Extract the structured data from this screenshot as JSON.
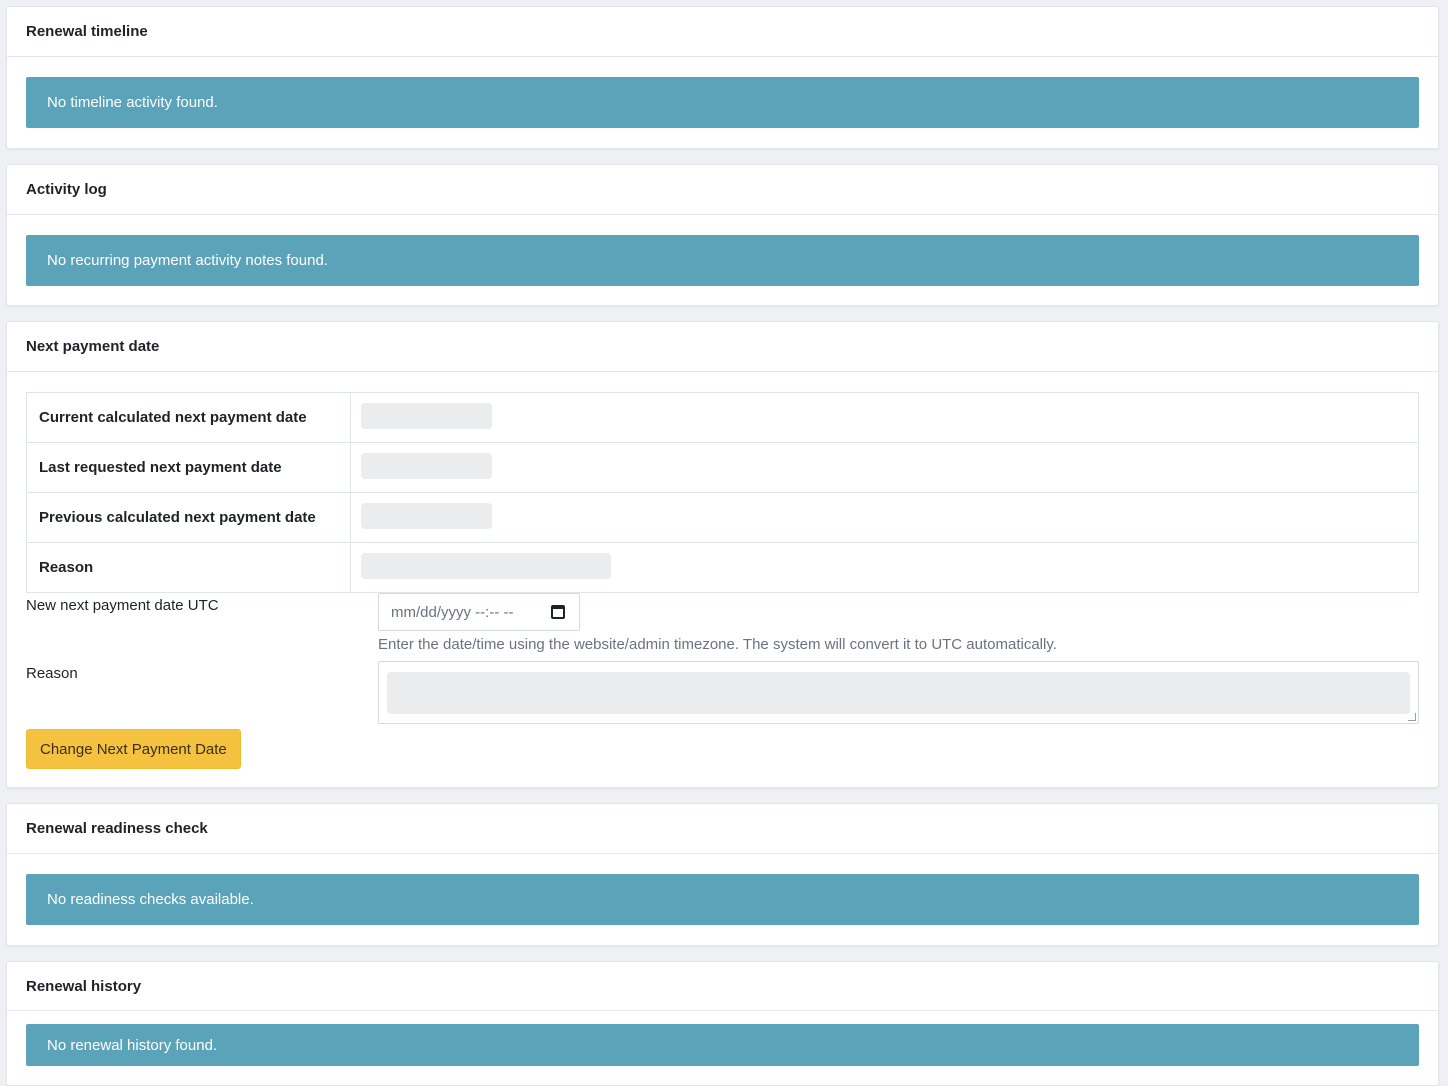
{
  "renewal_timeline": {
    "title": "Renewal timeline",
    "message": "No timeline activity found."
  },
  "activity_log": {
    "title": "Activity log",
    "message": "No recurring payment activity notes found."
  },
  "next_payment": {
    "title": "Next payment date",
    "rows": [
      {
        "label": "Current calculated next payment date"
      },
      {
        "label": "Last requested next payment date"
      },
      {
        "label": "Previous calculated next payment date"
      },
      {
        "label": "Reason"
      }
    ],
    "new_date_label": "New next payment date UTC",
    "date_placeholder": "mm/dd/yyyy --:-- --",
    "help_text": "Enter the date/time using the website/admin timezone. The system will convert it to UTC automatically.",
    "reason_label": "Reason",
    "button_label": "Change Next Payment Date"
  },
  "readiness": {
    "title": "Renewal readiness check",
    "message": "No readiness checks available."
  },
  "history": {
    "title": "Renewal history",
    "message": "No renewal history found."
  }
}
